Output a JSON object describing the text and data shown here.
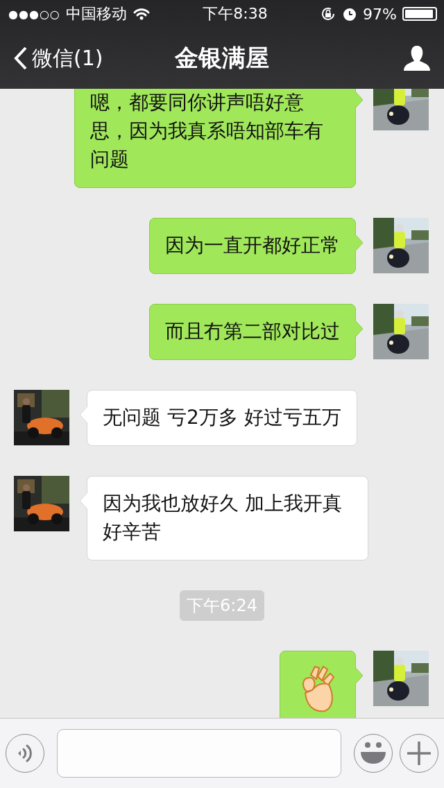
{
  "status_bar": {
    "signal_dots": "●●●○○",
    "carrier": "中国移动",
    "time": "下午8:38",
    "battery": "97%"
  },
  "nav": {
    "back_label": "微信(1)",
    "title": "金银满屋"
  },
  "messages": [
    {
      "kind": "sent_text",
      "text": "嗯，都要同你讲声唔好意思，因为我真系唔知部车有问题"
    },
    {
      "kind": "sent_text",
      "text": "因为一直开都好正常"
    },
    {
      "kind": "sent_text",
      "text": "而且冇第二部对比过"
    },
    {
      "kind": "received_text",
      "text": "无问题 亏2万多 好过亏五万"
    },
    {
      "kind": "received_text",
      "text": "因为我也放好久 加上我开真好辛苦"
    },
    {
      "kind": "time",
      "text": "下午6:24"
    },
    {
      "kind": "sent_emoji"
    }
  ]
}
